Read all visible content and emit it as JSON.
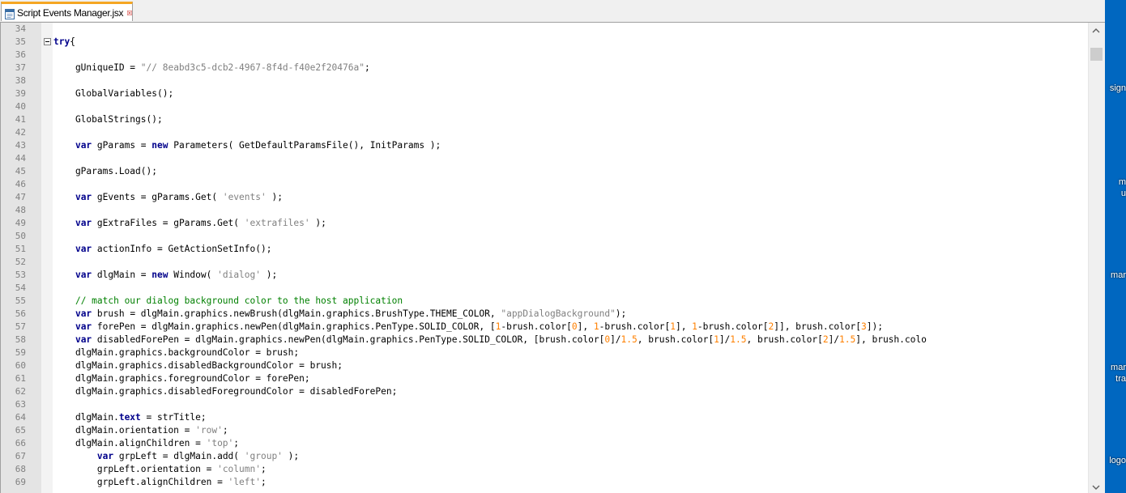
{
  "tab": {
    "title": "Script Events Manager.jsx",
    "icon": "file-icon",
    "close_icon": "close-icon"
  },
  "desktop": {
    "labels": [
      "sign",
      "m",
      "u",
      "mar",
      "mar",
      "tra",
      "logo"
    ]
  },
  "lines": [
    {
      "n": "34",
      "t": []
    },
    {
      "n": "35",
      "fold": true,
      "t": [
        [
          "kw",
          "try"
        ],
        [
          "",
          "{"
        ]
      ]
    },
    {
      "n": "36",
      "t": []
    },
    {
      "n": "37",
      "t": [
        [
          "",
          "    gUniqueID = "
        ],
        [
          "str",
          "\"// 8eabd3c5-dcb2-4967-8f4d-f40e2f20476a\""
        ],
        [
          "",
          ";"
        ]
      ]
    },
    {
      "n": "38",
      "t": []
    },
    {
      "n": "39",
      "t": [
        [
          "",
          "    GlobalVariables();"
        ]
      ]
    },
    {
      "n": "40",
      "t": []
    },
    {
      "n": "41",
      "t": [
        [
          "",
          "    GlobalStrings();"
        ]
      ]
    },
    {
      "n": "42",
      "t": []
    },
    {
      "n": "43",
      "t": [
        [
          "",
          "    "
        ],
        [
          "kw",
          "var"
        ],
        [
          "",
          " gParams = "
        ],
        [
          "kw",
          "new"
        ],
        [
          "",
          " Parameters( GetDefaultParamsFile(), InitParams );"
        ]
      ]
    },
    {
      "n": "44",
      "t": []
    },
    {
      "n": "45",
      "t": [
        [
          "",
          "    gParams.Load();"
        ]
      ]
    },
    {
      "n": "46",
      "t": []
    },
    {
      "n": "47",
      "t": [
        [
          "",
          "    "
        ],
        [
          "kw",
          "var"
        ],
        [
          "",
          " gEvents = gParams.Get( "
        ],
        [
          "str",
          "'events'"
        ],
        [
          "",
          " );"
        ]
      ]
    },
    {
      "n": "48",
      "t": []
    },
    {
      "n": "49",
      "t": [
        [
          "",
          "    "
        ],
        [
          "kw",
          "var"
        ],
        [
          "",
          " gExtraFiles = gParams.Get( "
        ],
        [
          "str",
          "'extrafiles'"
        ],
        [
          "",
          " );"
        ]
      ]
    },
    {
      "n": "50",
      "t": []
    },
    {
      "n": "51",
      "t": [
        [
          "",
          "    "
        ],
        [
          "kw",
          "var"
        ],
        [
          "",
          " actionInfo = GetActionSetInfo();"
        ]
      ]
    },
    {
      "n": "52",
      "t": []
    },
    {
      "n": "53",
      "t": [
        [
          "",
          "    "
        ],
        [
          "kw",
          "var"
        ],
        [
          "",
          " dlgMain = "
        ],
        [
          "kw",
          "new"
        ],
        [
          "",
          " Window( "
        ],
        [
          "str",
          "'dialog'"
        ],
        [
          "",
          " );"
        ]
      ]
    },
    {
      "n": "54",
      "t": []
    },
    {
      "n": "55",
      "t": [
        [
          "",
          "    "
        ],
        [
          "com",
          "// match our dialog background color to the host application"
        ]
      ]
    },
    {
      "n": "56",
      "t": [
        [
          "",
          "    "
        ],
        [
          "kw",
          "var"
        ],
        [
          "",
          " brush = dlgMain.graphics.newBrush(dlgMain.graphics.BrushType.THEME_COLOR, "
        ],
        [
          "str",
          "\"appDialogBackground\""
        ],
        [
          "",
          ");"
        ]
      ]
    },
    {
      "n": "57",
      "t": [
        [
          "",
          "    "
        ],
        [
          "kw",
          "var"
        ],
        [
          "",
          " forePen = dlgMain.graphics.newPen(dlgMain.graphics.PenType.SOLID_COLOR, ["
        ],
        [
          "num",
          "1"
        ],
        [
          "",
          "-brush.color["
        ],
        [
          "num",
          "0"
        ],
        [
          "",
          "], "
        ],
        [
          "num",
          "1"
        ],
        [
          "",
          "-brush.color["
        ],
        [
          "num",
          "1"
        ],
        [
          "",
          "], "
        ],
        [
          "num",
          "1"
        ],
        [
          "",
          "-brush.color["
        ],
        [
          "num",
          "2"
        ],
        [
          "",
          "]], brush.color["
        ],
        [
          "num",
          "3"
        ],
        [
          "",
          "]);"
        ]
      ]
    },
    {
      "n": "58",
      "t": [
        [
          "",
          "    "
        ],
        [
          "kw",
          "var"
        ],
        [
          "",
          " disabledForePen = dlgMain.graphics.newPen(dlgMain.graphics.PenType.SOLID_COLOR, [brush.color["
        ],
        [
          "num",
          "0"
        ],
        [
          "",
          "]/"
        ],
        [
          "num",
          "1.5"
        ],
        [
          "",
          ", brush.color["
        ],
        [
          "num",
          "1"
        ],
        [
          "",
          "]/"
        ],
        [
          "num",
          "1.5"
        ],
        [
          "",
          ", brush.color["
        ],
        [
          "num",
          "2"
        ],
        [
          "",
          "]/"
        ],
        [
          "num",
          "1.5"
        ],
        [
          "",
          "], brush.colo"
        ]
      ]
    },
    {
      "n": "59",
      "t": [
        [
          "",
          "    dlgMain.graphics.backgroundColor = brush;"
        ]
      ]
    },
    {
      "n": "60",
      "t": [
        [
          "",
          "    dlgMain.graphics.disabledBackgroundColor = brush;"
        ]
      ]
    },
    {
      "n": "61",
      "t": [
        [
          "",
          "    dlgMain.graphics.foregroundColor = forePen;"
        ]
      ]
    },
    {
      "n": "62",
      "t": [
        [
          "",
          "    dlgMain.graphics.disabledForegroundColor = disabledForePen;"
        ]
      ]
    },
    {
      "n": "63",
      "t": []
    },
    {
      "n": "64",
      "t": [
        [
          "",
          "    dlgMain."
        ],
        [
          "kw",
          "text"
        ],
        [
          "",
          " = strTitle;"
        ]
      ]
    },
    {
      "n": "65",
      "t": [
        [
          "",
          "    dlgMain.orientation = "
        ],
        [
          "str",
          "'row'"
        ],
        [
          "",
          ";"
        ]
      ]
    },
    {
      "n": "66",
      "t": [
        [
          "",
          "    dlgMain.alignChildren = "
        ],
        [
          "str",
          "'top'"
        ],
        [
          "",
          ";"
        ]
      ]
    },
    {
      "n": "67",
      "t": [
        [
          "",
          "        "
        ],
        [
          "kw",
          "var"
        ],
        [
          "",
          " grpLeft = dlgMain.add( "
        ],
        [
          "str",
          "'group'"
        ],
        [
          "",
          " );"
        ]
      ]
    },
    {
      "n": "68",
      "t": [
        [
          "",
          "        grpLeft.orientation = "
        ],
        [
          "str",
          "'column'"
        ],
        [
          "",
          ";"
        ]
      ]
    },
    {
      "n": "69",
      "t": [
        [
          "",
          "        grpLeft.alignChildren = "
        ],
        [
          "str",
          "'left'"
        ],
        [
          "",
          ";"
        ]
      ]
    }
  ]
}
